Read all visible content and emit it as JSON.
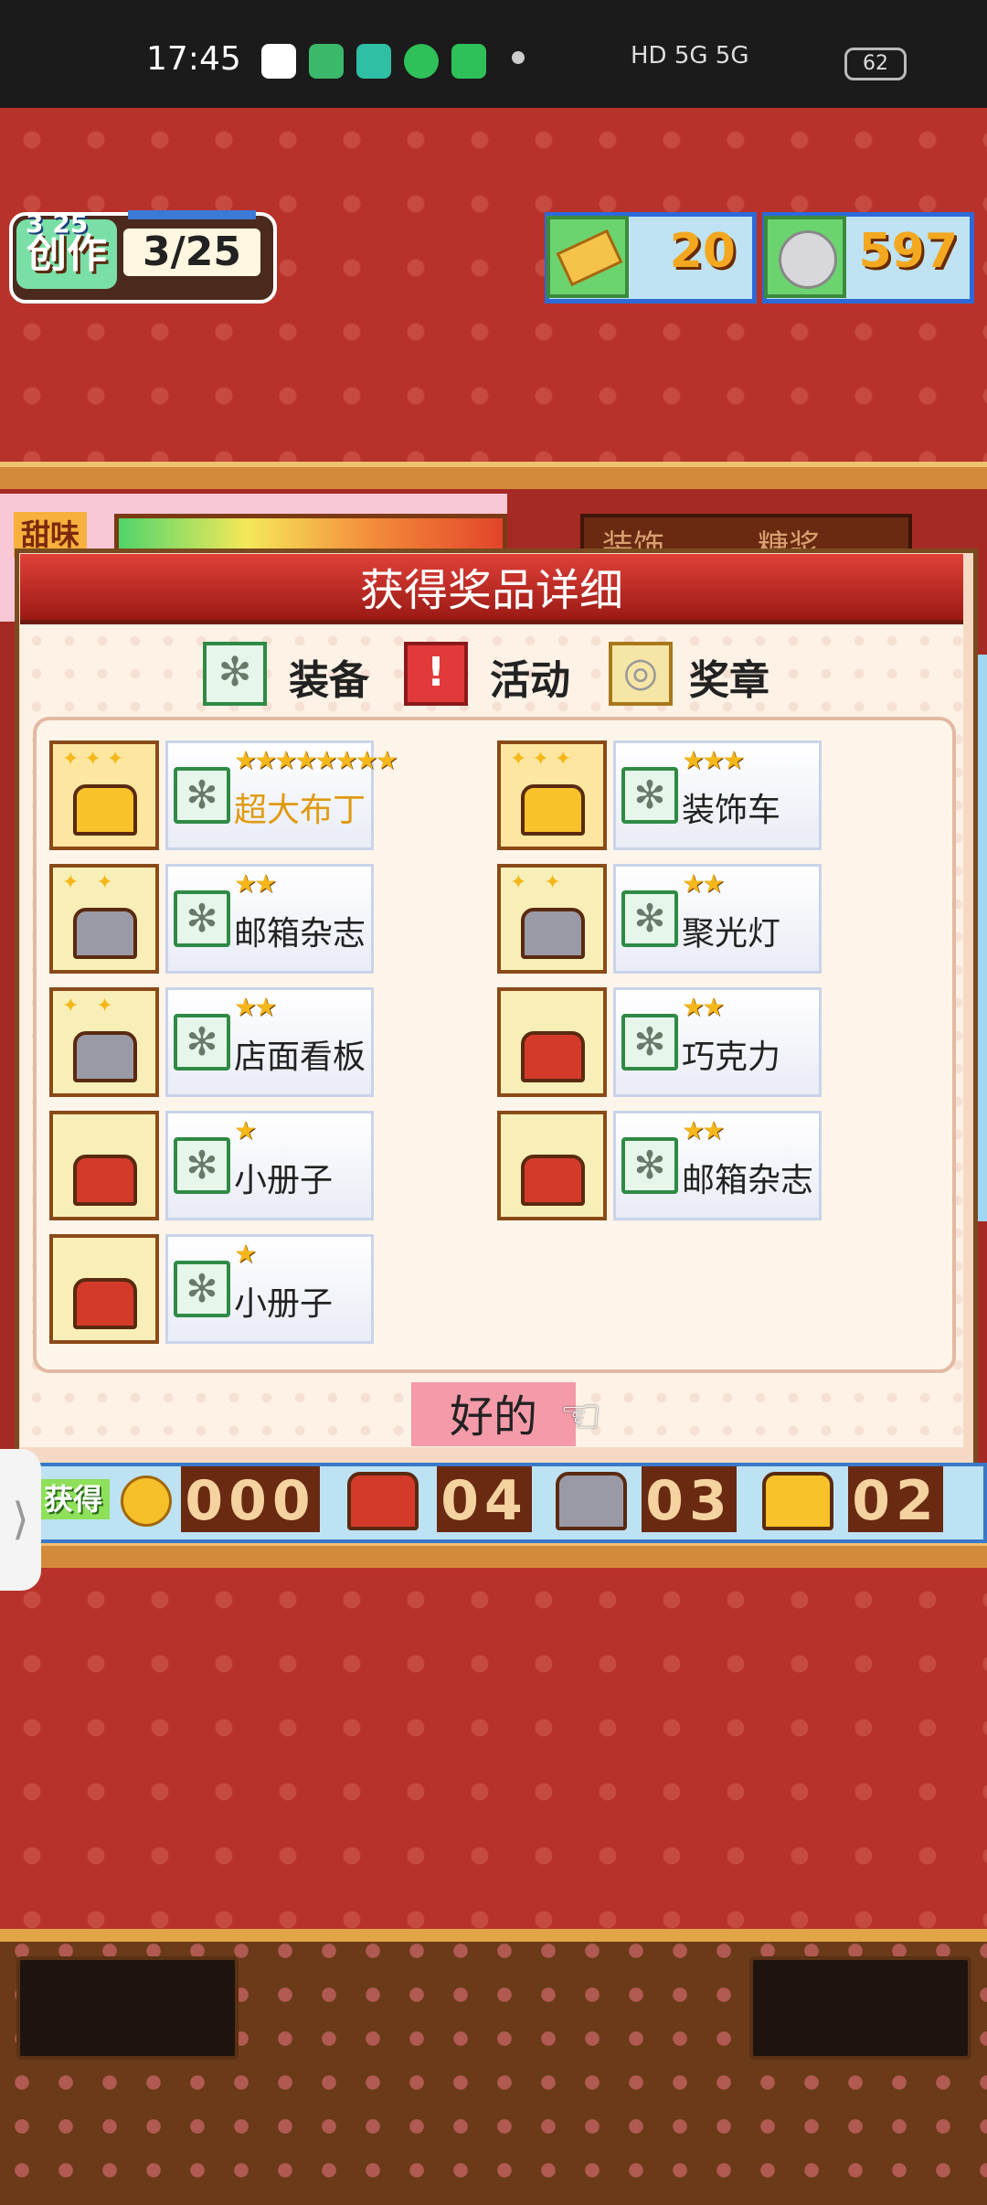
{
  "status_bar": {
    "time": "17:45",
    "right_text": "HD 5G 5G",
    "battery": "62"
  },
  "hud": {
    "date": "3 25",
    "create_label": "创作",
    "create_progress": "3/25",
    "tickets": "20",
    "coins": "597"
  },
  "background": {
    "sweet_label": "甜味",
    "tabs": [
      "装饰",
      "糖浆"
    ]
  },
  "dialog": {
    "title": "获得奖品详细",
    "legend": [
      {
        "label": "装备",
        "icon": "gear-icon"
      },
      {
        "label": "活动",
        "icon": "exclamation-icon"
      },
      {
        "label": "奖章",
        "icon": "medal-icon"
      }
    ],
    "items": [
      {
        "name": "超大布丁",
        "stars": "★★★★★★★★",
        "chest": "gold",
        "highlight": true
      },
      {
        "name": "装饰车",
        "stars": "★★★",
        "chest": "gold",
        "highlight": false
      },
      {
        "name": "邮箱杂志",
        "stars": "★★",
        "chest": "silver",
        "highlight": false
      },
      {
        "name": "聚光灯",
        "stars": "★★",
        "chest": "silver",
        "highlight": false
      },
      {
        "name": "店面看板",
        "stars": "★★",
        "chest": "silver",
        "highlight": false
      },
      {
        "name": "巧克力",
        "stars": "★★",
        "chest": "red",
        "highlight": false
      },
      {
        "name": "小册子",
        "stars": "★",
        "chest": "red",
        "highlight": false
      },
      {
        "name": "邮箱杂志",
        "stars": "★★",
        "chest": "red",
        "highlight": false
      },
      {
        "name": "小册子",
        "stars": "★",
        "chest": "red",
        "highlight": false
      }
    ],
    "ok_label": "好的"
  },
  "counters": {
    "obtain_label": "获得",
    "coin_count": "000",
    "red_chest_count": "04",
    "silver_chest_count": "03",
    "gold_chest_count": "02"
  },
  "side_handle_label": "⟩"
}
